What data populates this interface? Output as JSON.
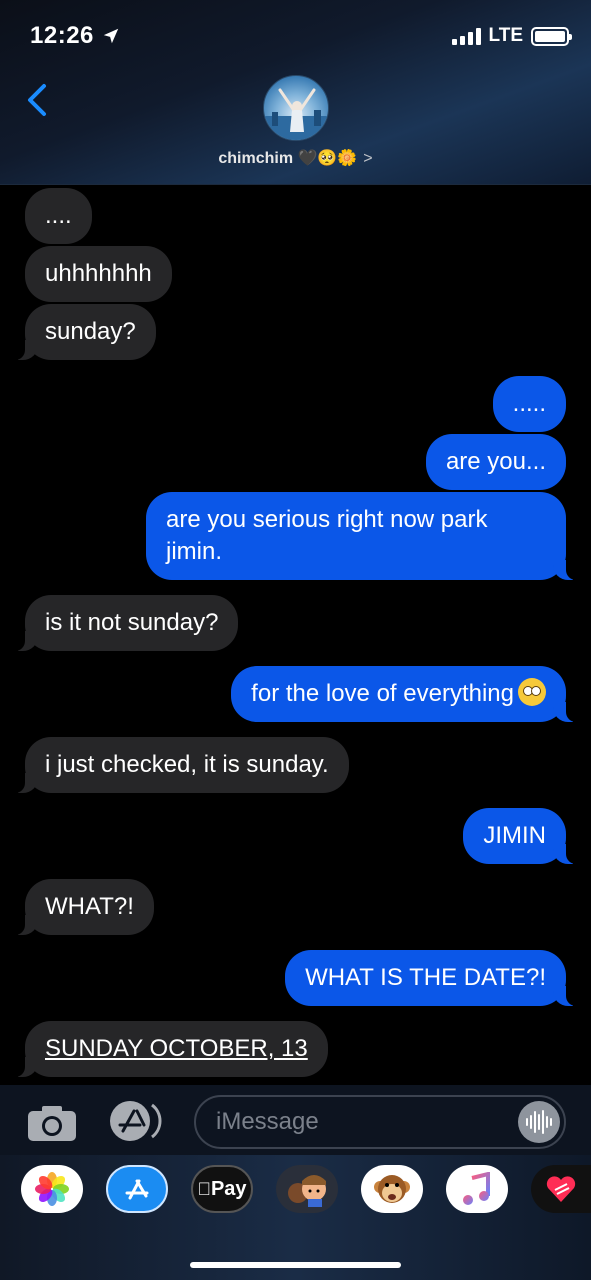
{
  "status_bar": {
    "time": "12:26",
    "network": "LTE"
  },
  "contact": {
    "name": "chimchim 🖤🥺🌼",
    "chevron": ">"
  },
  "messages": [
    {
      "from": "them",
      "text": "...."
    },
    {
      "from": "them",
      "text": "uhhhhhhh"
    },
    {
      "from": "them",
      "text": "sunday?"
    },
    {
      "from": "me",
      "text": "....."
    },
    {
      "from": "me",
      "text": "are you..."
    },
    {
      "from": "me",
      "text": "are you serious right now park jimin."
    },
    {
      "from": "them",
      "text": "is it not sunday?"
    },
    {
      "from": "me",
      "text": "for the love of everything"
    },
    {
      "from": "them",
      "text": "i just checked, it is sunday."
    },
    {
      "from": "me",
      "text": "JIMIN"
    },
    {
      "from": "them",
      "text": "WHAT?!"
    },
    {
      "from": "me",
      "text": "WHAT IS THE DATE?!"
    },
    {
      "from": "them",
      "text": "SUNDAY OCTOBER, 13"
    }
  ],
  "input": {
    "placeholder": "iMessage"
  },
  "app_drawer": {
    "apps": [
      "photos-icon",
      "app-store-icon",
      "apple-pay-icon",
      "memoji-icon",
      "animoji-icon",
      "music-icon",
      "digital-touch-icon"
    ],
    "apple_pay_label": "Pay"
  },
  "colors": {
    "sent_bubble": "#0b57e8",
    "received_bubble": "#262628",
    "accent": "#1a8cff"
  }
}
